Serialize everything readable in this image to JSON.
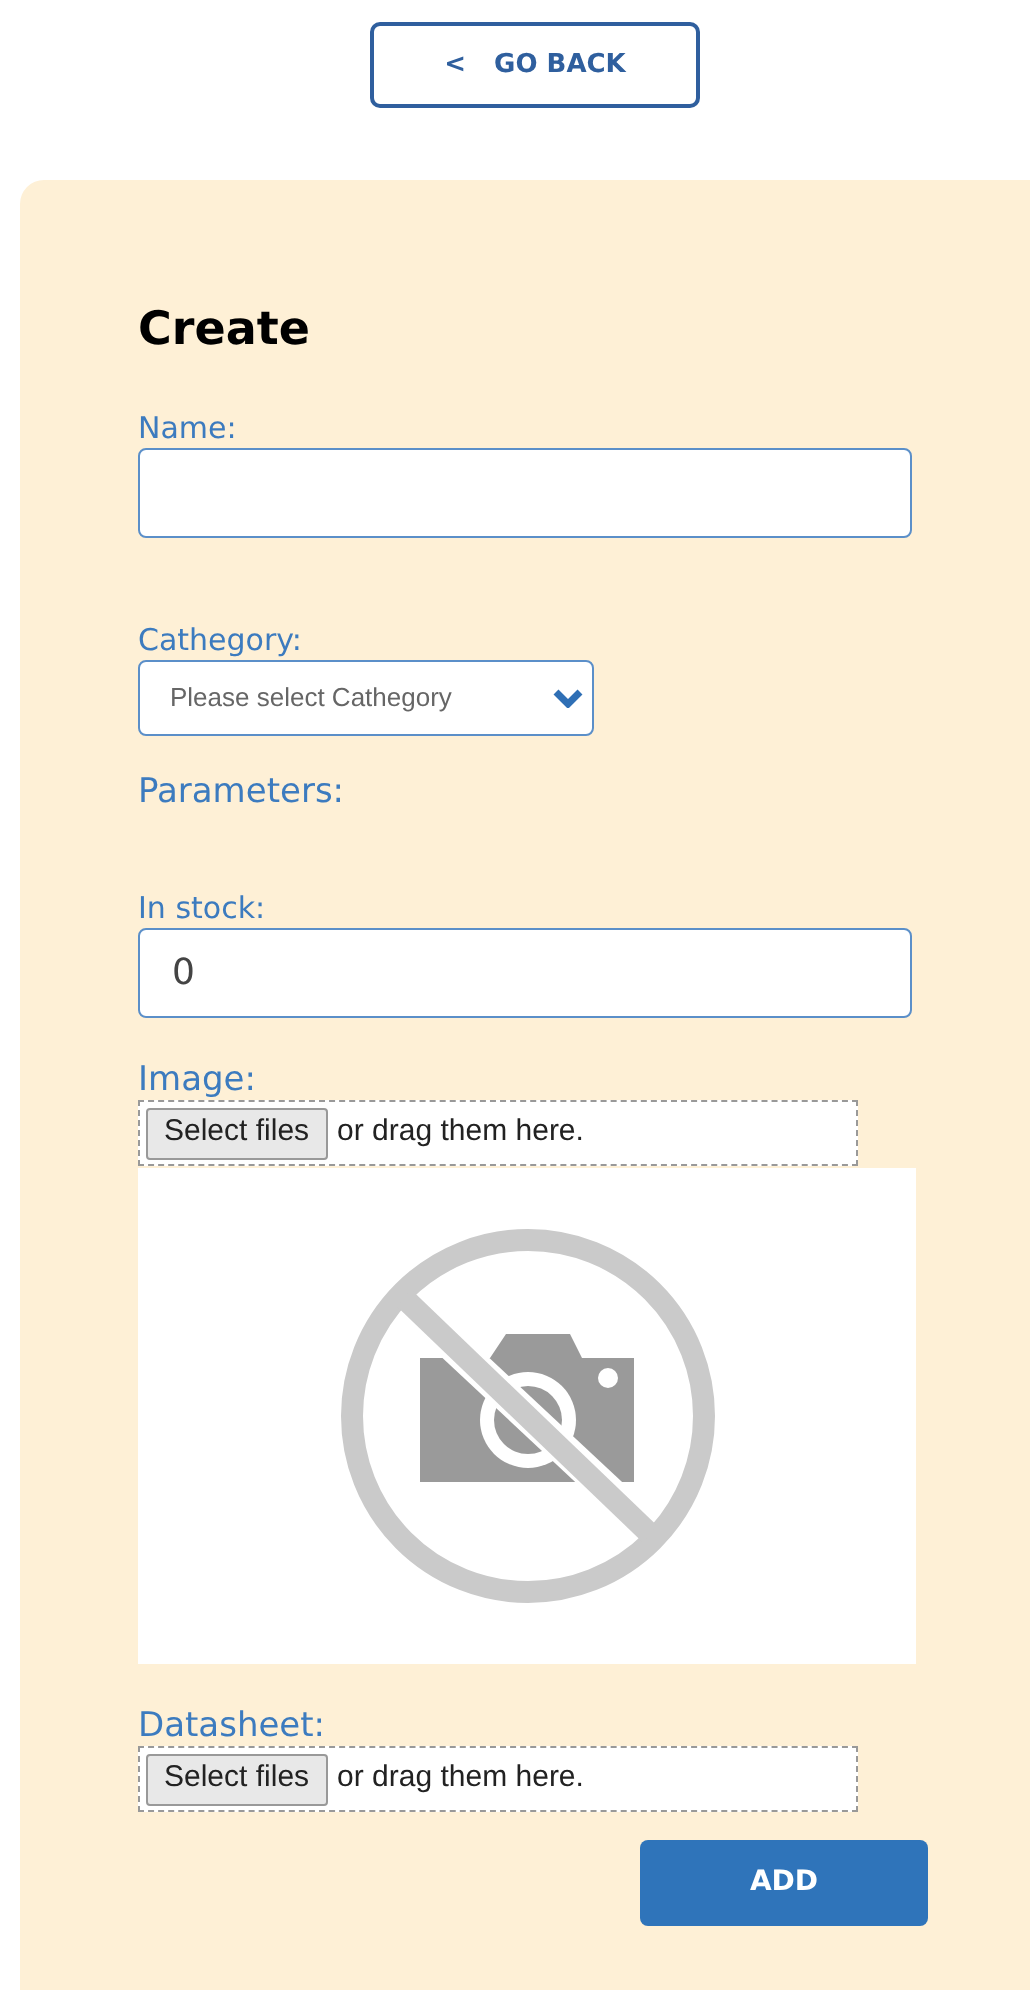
{
  "back_button": {
    "icon": "<",
    "label": "GO BACK"
  },
  "form": {
    "title": "Create",
    "fields": [
      {
        "kind": "text",
        "label": "Name:"
      },
      {
        "kind": "select",
        "label": "Cathegory:",
        "placeholder": "Please select Cathegory"
      },
      {
        "kind": "heading",
        "label": "Parameters:"
      },
      {
        "kind": "text",
        "label": "In stock:",
        "value": "0"
      },
      {
        "kind": "file",
        "label": "Image:",
        "button": "Select files",
        "hint": "or drag them here.",
        "preview": true
      },
      {
        "kind": "file",
        "label": "Datasheet:",
        "button": "Select files",
        "hint": "or drag them here.",
        "preview": false
      }
    ],
    "submit": "ADD"
  }
}
